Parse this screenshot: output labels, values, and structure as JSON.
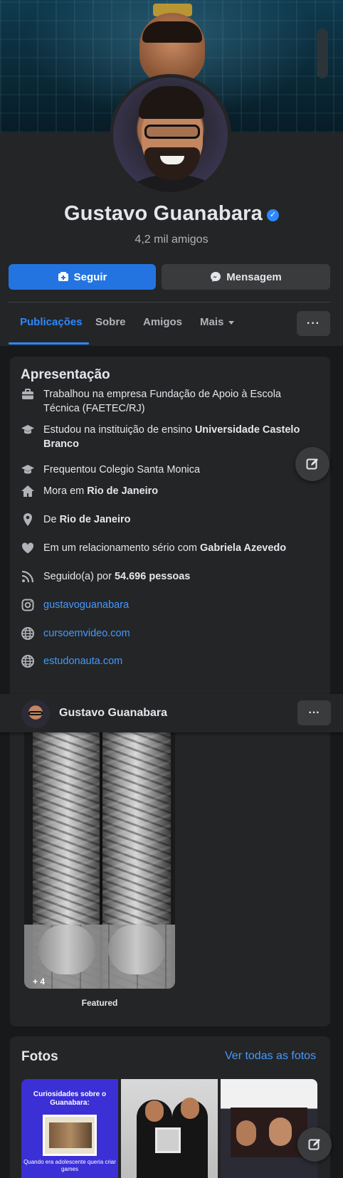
{
  "profile": {
    "name": "Gustavo Guanabara",
    "friends": "4,2 mil amigos"
  },
  "actions": {
    "follow_label": "Seguir",
    "message_label": "Mensagem"
  },
  "tabs": {
    "items": [
      {
        "label": "Publicações",
        "active": true
      },
      {
        "label": "Sobre"
      },
      {
        "label": "Amigos"
      },
      {
        "label": "Mais"
      }
    ],
    "more_button": "···"
  },
  "intro": {
    "title": "Apresentação",
    "items": [
      {
        "icon": "briefcase-icon",
        "prefix": "Trabalhou na empresa Fundação de Apoio à Escola Técnica (FAETEC/RJ)",
        "bold": ""
      },
      {
        "icon": "graduation-cap-icon",
        "prefix": "Estudou na instituição de ensino ",
        "bold": "Universidade Castelo Branco"
      },
      {
        "icon": "graduation-cap-icon",
        "prefix": "Frequentou Colegio Santa Monica",
        "bold": ""
      },
      {
        "icon": "home-icon",
        "prefix": "Mora em ",
        "bold": "Rio de Janeiro"
      },
      {
        "icon": "location-pin-icon",
        "prefix": "De ",
        "bold": "Rio de Janeiro"
      },
      {
        "icon": "heart-icon",
        "prefix": "Em um relacionamento sério com ",
        "bold": "Gabriela Azevedo"
      },
      {
        "icon": "rss-icon",
        "prefix": "Seguido(a) por ",
        "bold": "54.696 pessoas"
      }
    ],
    "links": [
      {
        "icon": "instagram-icon",
        "text": "gustavoguanabara"
      },
      {
        "icon": "globe-icon",
        "text": "cursoemvideo.com"
      },
      {
        "icon": "globe-icon",
        "text": "estudonauta.com"
      }
    ]
  },
  "sticky": {
    "name": "Gustavo Guanabara",
    "more_button": "···"
  },
  "featured": {
    "extra_count": "+ 4",
    "label": "Featured"
  },
  "photos": {
    "title": "Fotos",
    "see_all": "Ver todas as fotos",
    "thumb1": {
      "heading": "Curiosidades sobre o Guanabara:",
      "caption": "Quando era adolescente queria criar games"
    }
  },
  "colors": {
    "accent": "#2d88ff",
    "button_primary": "#2374e1",
    "card": "#242526",
    "background": "#18191a",
    "link": "#4599ff"
  }
}
